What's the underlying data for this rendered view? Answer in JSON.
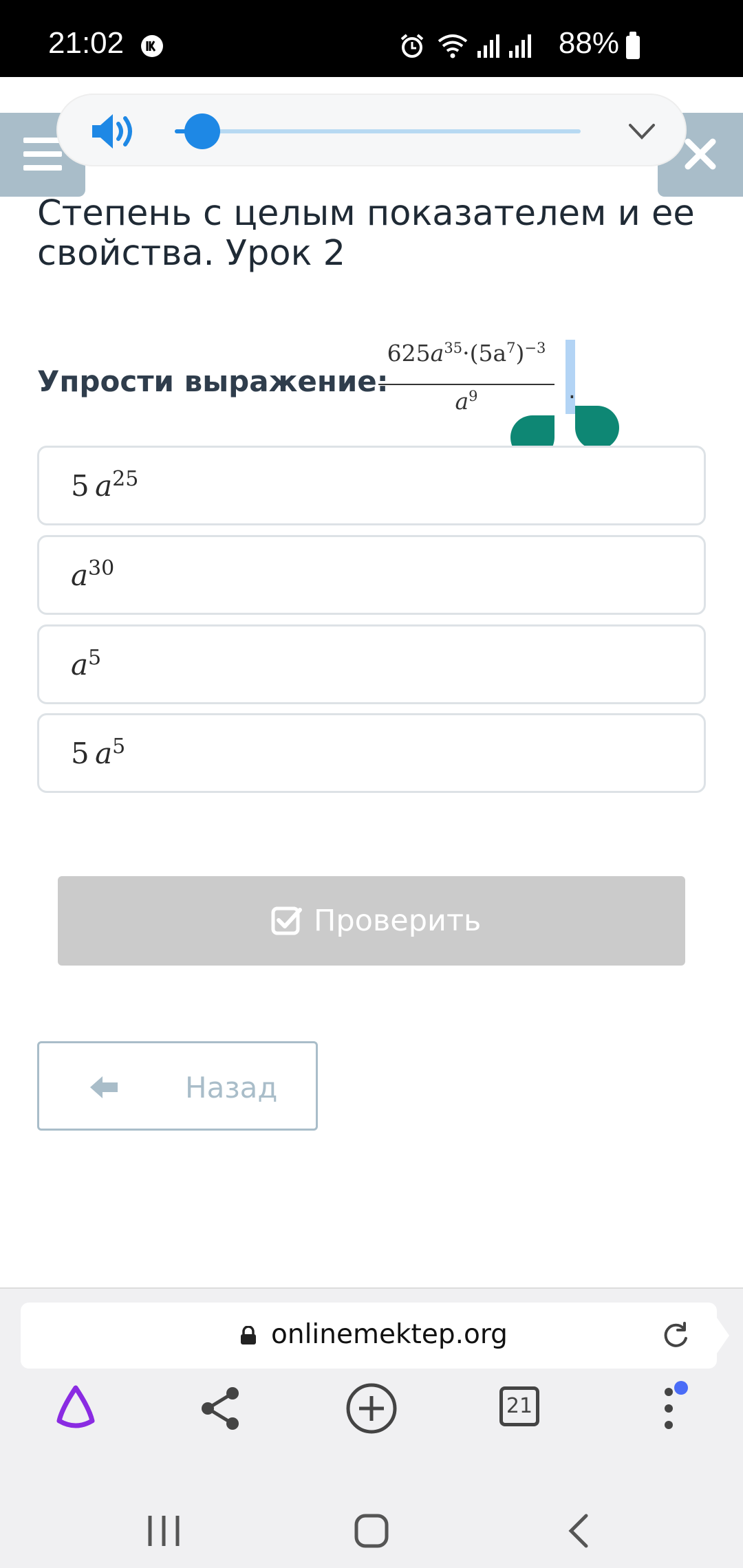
{
  "status_bar": {
    "time": "21:02",
    "battery": "88%"
  },
  "audio_player": {
    "progress": 0.05
  },
  "lesson": {
    "title": "Степень с целым показателем и ее свойства. Урок 2",
    "question_label": "Упрости выражение:",
    "formula": {
      "numerator_coef": "625",
      "numerator_var": "a",
      "numerator_exp": "35",
      "numerator_factor": "(5a",
      "inner_exp": "7",
      "outer_exp": "−3",
      "denominator_var": "a",
      "denominator_exp": "9"
    }
  },
  "options": [
    {
      "coef": "5",
      "var": "a",
      "exp": "25"
    },
    {
      "coef": "",
      "var": "a",
      "exp": "30"
    },
    {
      "coef": "",
      "var": "a",
      "exp": "5"
    },
    {
      "coef": "5",
      "var": "a",
      "exp": "5"
    }
  ],
  "buttons": {
    "check_label": "Проверить",
    "back_label": "Назад"
  },
  "browser": {
    "url": "onlinemektep.org",
    "tabs_count": "21"
  },
  "colors": {
    "accent_blue": "#1e88e5",
    "tab_gray": "#a9bdc9",
    "handle_green": "#0e8774",
    "button_disabled": "#cbcbcb"
  }
}
